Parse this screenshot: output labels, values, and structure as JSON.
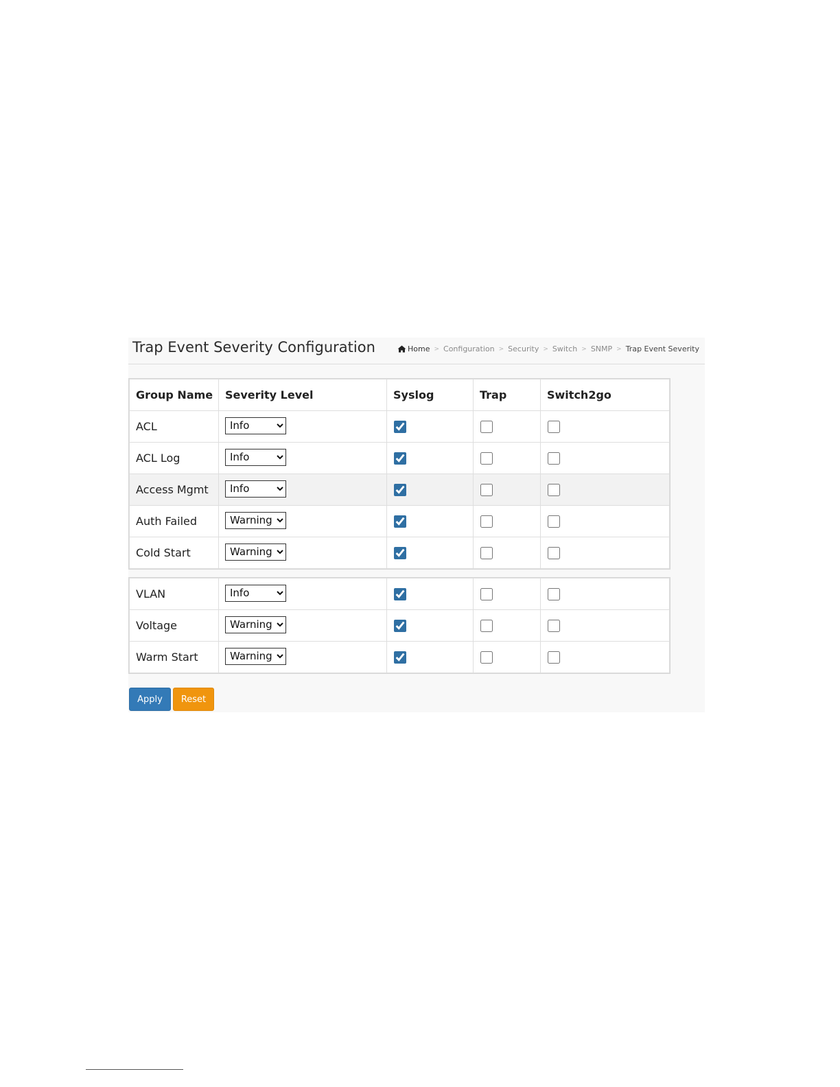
{
  "header": {
    "title": "Trap Event Severity Configuration",
    "breadcrumb": {
      "home": "Home",
      "items": [
        "Configuration",
        "Security",
        "Switch",
        "SNMP"
      ],
      "current": "Trap Event Severity",
      "separator": ">"
    }
  },
  "table": {
    "columns": {
      "group": "Group Name",
      "severity": "Severity Level",
      "syslog": "Syslog",
      "trap": "Trap",
      "switch2go": "Switch2go"
    },
    "rows_top": [
      {
        "group": "ACL",
        "severity": "Info",
        "syslog": true,
        "trap": false,
        "switch2go": false
      },
      {
        "group": "ACL Log",
        "severity": "Info",
        "syslog": true,
        "trap": false,
        "switch2go": false
      },
      {
        "group": "Access Mgmt",
        "severity": "Info",
        "syslog": true,
        "trap": false,
        "switch2go": false
      },
      {
        "group": "Auth Failed",
        "severity": "Warning",
        "syslog": true,
        "trap": false,
        "switch2go": false
      },
      {
        "group": "Cold Start",
        "severity": "Warning",
        "syslog": true,
        "trap": false,
        "switch2go": false
      }
    ],
    "rows_bottom": [
      {
        "group": "VLAN",
        "severity": "Info",
        "syslog": true,
        "trap": false,
        "switch2go": false
      },
      {
        "group": "Voltage",
        "severity": "Warning",
        "syslog": true,
        "trap": false,
        "switch2go": false
      },
      {
        "group": "Warm Start",
        "severity": "Warning",
        "syslog": true,
        "trap": false,
        "switch2go": false
      }
    ]
  },
  "buttons": {
    "apply": "Apply",
    "reset": "Reset"
  },
  "colors": {
    "apply": "#337ab7",
    "reset": "#f0950e",
    "checkbox": "#2f6fa3"
  }
}
